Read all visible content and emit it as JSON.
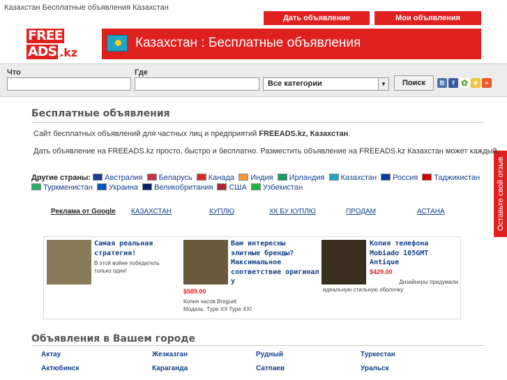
{
  "top_line": "Казахстан Бесплатные объявления Казахстан",
  "header": {
    "post_button": "Дать объявление",
    "my_ads_button": "Мои объявления",
    "logo_free": "FREE",
    "logo_ads": "ADS",
    "logo_kz": ".kz",
    "banner_title": "Казахстан : Бесплатные объявления"
  },
  "search": {
    "what_label": "Что",
    "where_label": "Где",
    "what_value": "",
    "where_value": "",
    "category": "Все категории",
    "button": "Поиск"
  },
  "social": [
    "В",
    "f",
    "✿",
    "★",
    "+"
  ],
  "feedback_tab": "Оставьте свой отзыв",
  "main": {
    "title": "Бесплатные объявления",
    "para1_a": "Сайт бесплатных объявлений для частных лиц и предприятий ",
    "para1_b": "FREEADS.kz, Казахстан",
    "para1_c": ".",
    "para2": "Дать объявление на FREEADS.kz просто, быстро и бесплатно. Разместить объявление на FREEADS.kz Казахстан может каждый.",
    "countries_label": "Другие страны:",
    "countries": [
      {
        "name": "Австралия",
        "color": "#1e3a8a"
      },
      {
        "name": "Беларусь",
        "color": "#c8313e"
      },
      {
        "name": "Канада",
        "color": "#d52b1e"
      },
      {
        "name": "Индия",
        "color": "#ff9933"
      },
      {
        "name": "Ирландия",
        "color": "#169b62"
      },
      {
        "name": "Казахстан",
        "color": "#1fa3c7"
      },
      {
        "name": "Россия",
        "color": "#0039a6"
      },
      {
        "name": "Таджикистан",
        "color": "#cc0000"
      },
      {
        "name": "Туркменистан",
        "color": "#28ae66"
      },
      {
        "name": "Украина",
        "color": "#0057b7"
      },
      {
        "name": "Великобритания",
        "color": "#012169"
      },
      {
        "name": "США",
        "color": "#b22234"
      },
      {
        "name": "Узбекистан",
        "color": "#1eb53a"
      }
    ]
  },
  "google_ads": {
    "label": "Реклама от Google",
    "links": [
      "КАЗАХСТАН",
      "КУПЛЮ",
      "ХК БУ КУПЛЮ",
      "ПРОДАМ",
      "АСТАНА"
    ]
  },
  "ads": [
    {
      "title": [
        "Самая реальная",
        "стратегия!"
      ],
      "text": [
        "В этой войне победитель",
        "только один!"
      ]
    },
    {
      "title": [
        "Вам интересны",
        "элитные бренды?",
        "Максимальное",
        "соответствие оригинал",
        "у"
      ],
      "price": "$589.00",
      "text": [
        "Копия часов Breguet",
        "Модель: Type XX Type XXI"
      ]
    },
    {
      "title": [
        "Копия телефона",
        "Mobiado 105GMT",
        "Antique"
      ],
      "price": "$429.00",
      "text": [
        "Дизайнеры придумали",
        "идеальную стильную оболочку"
      ]
    }
  ],
  "cities_section": {
    "title": "Объявления в Вашем городе",
    "cities": [
      "Актау",
      "Жезказган",
      "Рудный",
      "Туркестан",
      "Актюбинск",
      "Караганда",
      "Сатпаев",
      "Уральск"
    ]
  }
}
